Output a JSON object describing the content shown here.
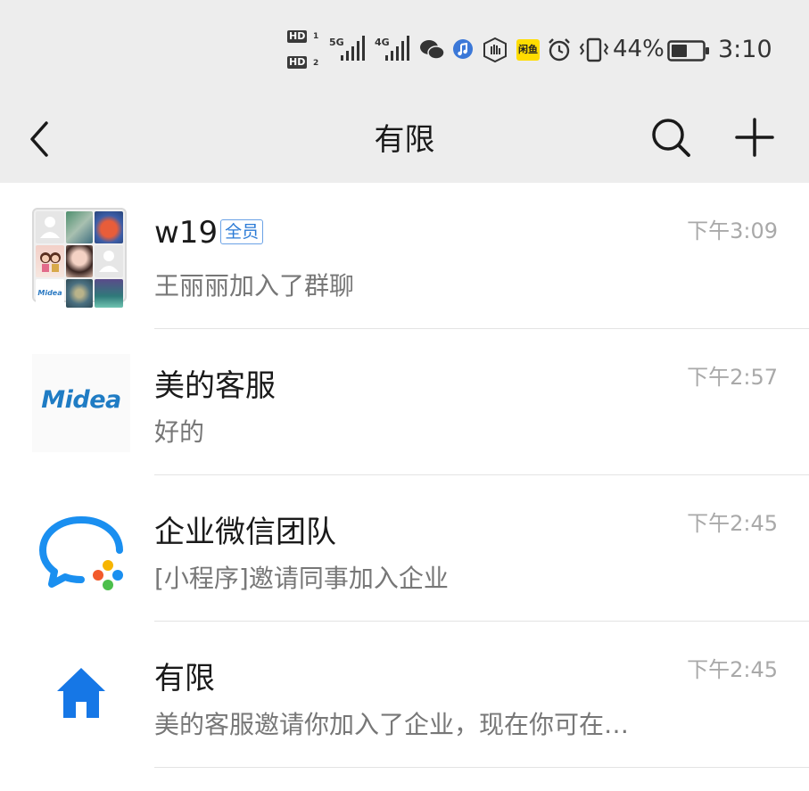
{
  "status_bar": {
    "hd1": "HD",
    "hd1_sub": "1",
    "hd2": "HD",
    "hd2_sub": "2",
    "net1": "5G",
    "net2": "4G",
    "battery_percent": "44%",
    "time": "3:10",
    "icons": [
      "hd-icon",
      "signal-icon",
      "wechat-icon",
      "music-icon",
      "hand-icon",
      "xianyu-icon",
      "alarm-icon",
      "vibrate-icon",
      "battery-icon"
    ],
    "yellow_badge": "闲鱼"
  },
  "header": {
    "title": "有限",
    "back_icon": "chevron-left-icon",
    "search_icon": "search-icon",
    "add_icon": "plus-icon"
  },
  "conversations": [
    {
      "name": "w19",
      "badge": "全员",
      "preview": "王丽丽加入了群聊",
      "time": "下午3:09",
      "avatar": "group-avatar-grid"
    },
    {
      "name": "美的客服",
      "preview": "好的",
      "time": "下午2:57",
      "avatar": "midea-logo",
      "avatar_text": "Midea"
    },
    {
      "name": "企业微信团队",
      "preview": "[小程序]邀请同事加入企业",
      "time": "下午2:45",
      "avatar": "wecom-logo"
    },
    {
      "name": "有限",
      "preview": "美的客服邀请你加入了企业，现在你可在…",
      "time": "下午2:45",
      "avatar": "home-icon"
    }
  ],
  "colors": {
    "header_bg": "#ededed",
    "accent_blue": "#2b7bd6",
    "home_blue": "#1677e6",
    "preview_gray": "#777777",
    "time_gray": "#a9a9a9"
  }
}
